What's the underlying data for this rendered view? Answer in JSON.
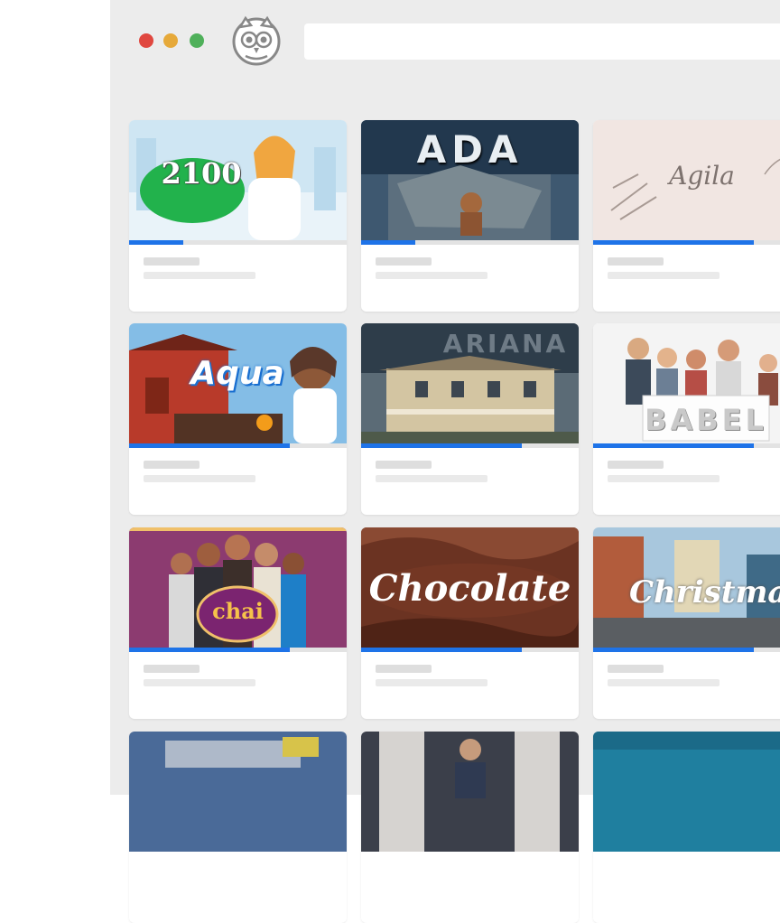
{
  "browser": {
    "traffic_lights": [
      {
        "name": "close",
        "color": "#e0473f"
      },
      {
        "name": "minimize",
        "color": "#e6a93a"
      },
      {
        "name": "maximize",
        "color": "#4fb05a"
      }
    ],
    "logo_icon": "owl-logo-icon",
    "address_value": ""
  },
  "cards": [
    {
      "title": "2100",
      "progress": 0.25
    },
    {
      "title": "ADA",
      "progress": 0.25
    },
    {
      "title": "Agila",
      "progress": 0.74
    },
    {
      "title": "Aqua",
      "progress": 0.74
    },
    {
      "title": "ARIANA",
      "progress": 0.74
    },
    {
      "title": "BABEL",
      "progress": 0.74
    },
    {
      "title": "chai",
      "progress": 0.74
    },
    {
      "title": "Chocolate",
      "progress": 0.74
    },
    {
      "title": "Christmas",
      "progress": 0.74
    },
    {
      "title": "",
      "progress": 0
    },
    {
      "title": "",
      "progress": 0
    },
    {
      "title": "",
      "progress": 0
    }
  ],
  "colors": {
    "accent": "#1e73e8",
    "window_bg": "#ececec",
    "card_bg": "#ffffff"
  }
}
